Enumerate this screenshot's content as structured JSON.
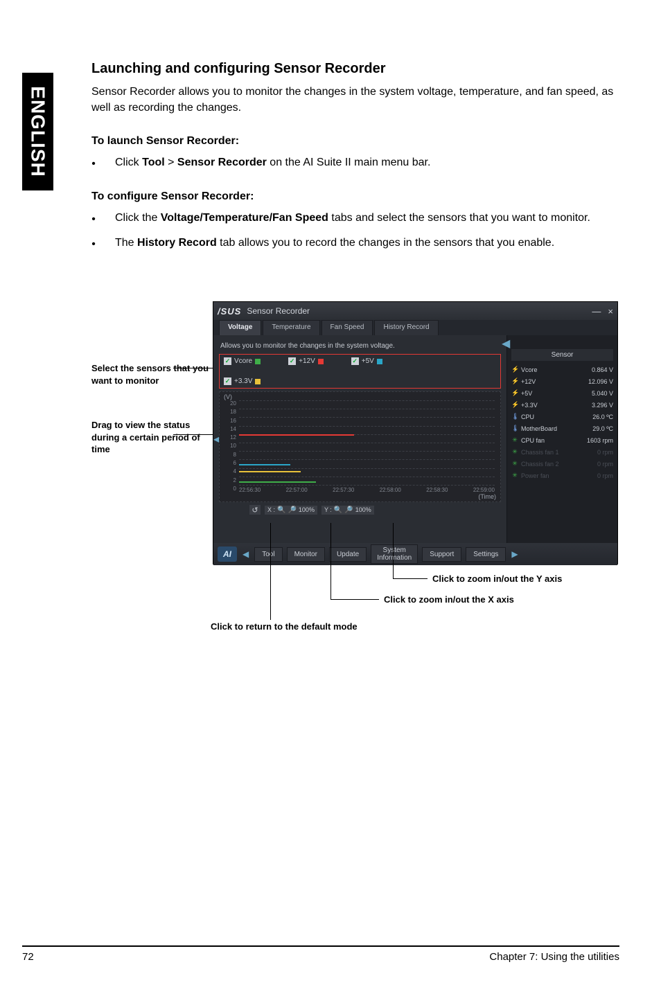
{
  "sideTab": "ENGLISH",
  "title": "Launching and configuring Sensor Recorder",
  "lead": "Sensor Recorder allows you to monitor the changes in the system voltage, temperature, and fan speed, as well as recording the changes.",
  "launchHead": "To launch Sensor Recorder:",
  "launchItem": {
    "pre": "Click ",
    "b1": "Tool",
    "mid": " > ",
    "b2": "Sensor Recorder",
    "post": " on the AI Suite II main menu bar."
  },
  "configHead": "To configure Sensor Recorder:",
  "configItems": [
    {
      "pre": "Click the ",
      "b": "Voltage/Temperature/Fan Speed",
      "post": " tabs and select the sensors that you want to monitor."
    },
    {
      "pre": "The ",
      "b": "History Record",
      "post": " tab allows you to record the changes in the sensors that you enable."
    }
  ],
  "ann": {
    "select": "Select the sensors that you want to monitor",
    "drag": "Drag to view the status during a certain period of time"
  },
  "callouts": {
    "yaxis": "Click to zoom in/out the Y axis",
    "xaxis": "Click to zoom in/out the X axis",
    "reset": "Click to return to the default mode"
  },
  "app": {
    "brand": "/SUS",
    "title": "Sensor Recorder",
    "winMin": "—",
    "winClose": "×",
    "tabs": [
      "Voltage",
      "Temperature",
      "Fan Speed",
      "History Record"
    ],
    "hint": "Allows you to monitor the changes in the system voltage.",
    "checks": [
      {
        "label": "Vcore",
        "color": "green"
      },
      {
        "label": "+12V",
        "color": "red"
      },
      {
        "label": "+5V",
        "color": "cyan"
      },
      {
        "label": "+3.3V",
        "color": "yellow"
      }
    ],
    "zoom": {
      "reset": "↺",
      "xLabel": "X :",
      "xPct": "100%",
      "yLabel": "Y :",
      "yPct": "100%",
      "zin": "🔍",
      "zout": "🔎"
    },
    "bottom": {
      "ai": "AI",
      "navPrev": "◀",
      "navNext": "▶",
      "btns": [
        "Tool",
        "Monitor",
        "Update"
      ],
      "sysInfo": "System\nInformation",
      "support": "Support",
      "settings": "Settings"
    },
    "sidebar": {
      "title": "Sensor",
      "rows": [
        {
          "icon": "volt",
          "name": "Vcore",
          "val": "0.864 V",
          "dim": false
        },
        {
          "icon": "volt",
          "name": "+12V",
          "val": "12.096 V",
          "dim": false
        },
        {
          "icon": "volt",
          "name": "+5V",
          "val": "5.040 V",
          "dim": false
        },
        {
          "icon": "volt",
          "name": "+3.3V",
          "val": "3.296 V",
          "dim": false
        },
        {
          "icon": "temp",
          "name": "CPU",
          "val": "26.0 ºC",
          "dim": false
        },
        {
          "icon": "temp",
          "name": "MotherBoard",
          "val": "29.0 ºC",
          "dim": false
        },
        {
          "icon": "fan",
          "name": "CPU fan",
          "val": "1603 rpm",
          "dim": false
        },
        {
          "icon": "fan",
          "name": "Chassis fan 1",
          "val": "0 rpm",
          "dim": true
        },
        {
          "icon": "fan",
          "name": "Chassis fan 2",
          "val": "0 rpm",
          "dim": true
        },
        {
          "icon": "fan",
          "name": "Power fan",
          "val": "0 rpm",
          "dim": true
        }
      ]
    },
    "arrows": {
      "left": "◀",
      "right": "◀"
    }
  },
  "chart_data": {
    "type": "line",
    "title": "",
    "xlabel": "(Time)",
    "ylabel": "(V)",
    "ylim": [
      0,
      20
    ],
    "yticks": [
      20,
      18,
      16,
      14,
      12,
      10,
      8,
      6,
      4,
      2,
      0
    ],
    "x": [
      "22:56:30",
      "22:57:00",
      "22:57:30",
      "22:58:00",
      "22:58:30",
      "22:59:00"
    ],
    "series": [
      {
        "name": "+12V",
        "color": "red",
        "approx_value": 12
      },
      {
        "name": "+5V",
        "color": "cyan",
        "approx_value": 5
      },
      {
        "name": "+3.3V",
        "color": "yellow",
        "approx_value": 3.3
      },
      {
        "name": "Vcore",
        "color": "green",
        "approx_value": 0.9
      }
    ]
  },
  "footer": {
    "page": "72",
    "chapter": "Chapter 7: Using the utilities"
  }
}
